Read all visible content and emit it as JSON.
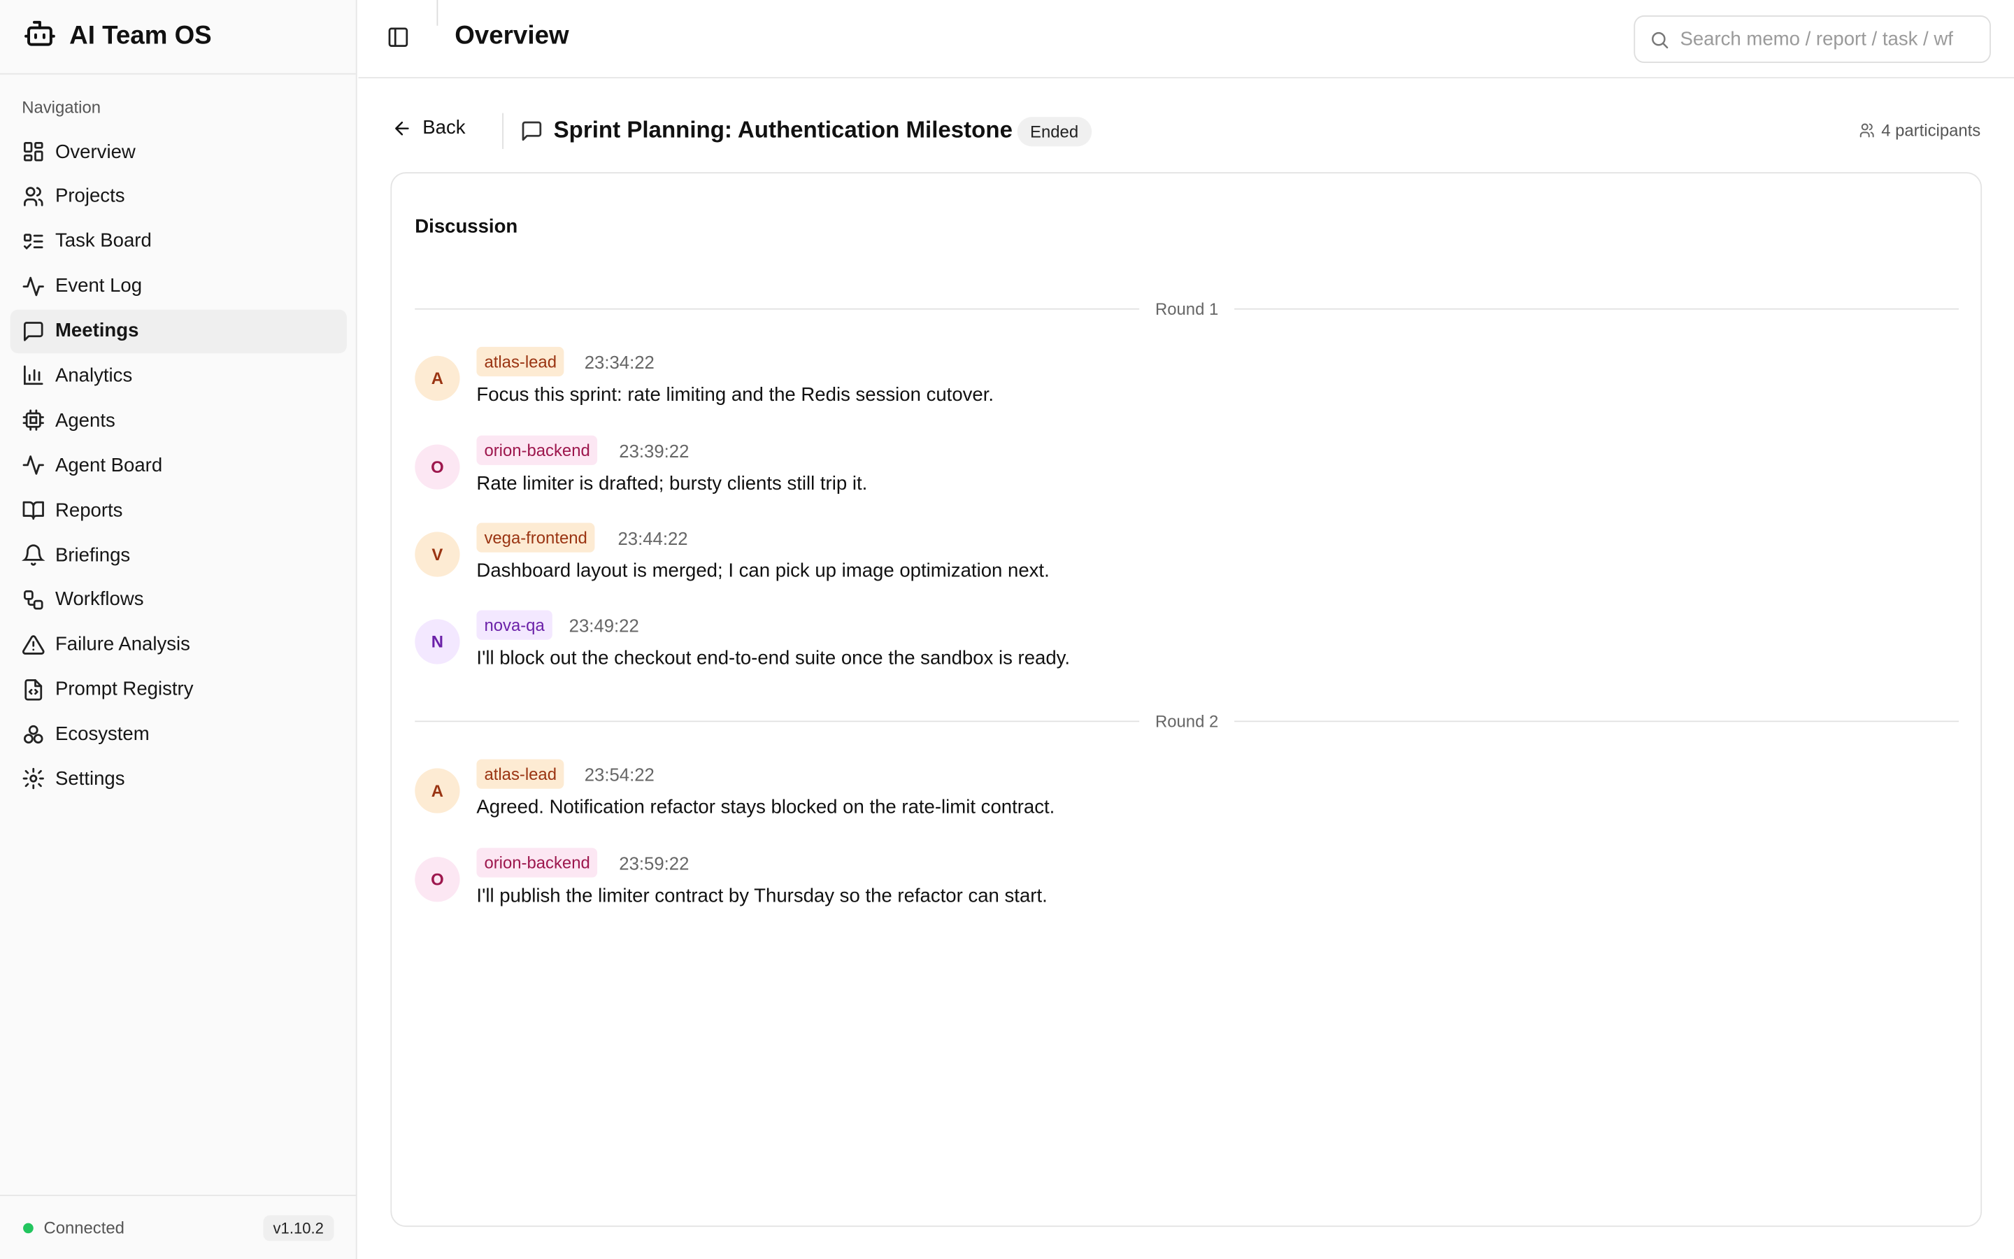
{
  "app": {
    "name": "AI Team OS",
    "connection": "Connected",
    "version": "v1.10.2"
  },
  "sidebar": {
    "heading": "Navigation",
    "items": [
      {
        "label": "Overview",
        "icon": "dashboard-icon"
      },
      {
        "label": "Projects",
        "icon": "users-icon"
      },
      {
        "label": "Task Board",
        "icon": "list-todo-icon"
      },
      {
        "label": "Event Log",
        "icon": "activity-icon"
      },
      {
        "label": "Meetings",
        "icon": "message-square-icon",
        "active": true
      },
      {
        "label": "Analytics",
        "icon": "bar-chart-icon"
      },
      {
        "label": "Agents",
        "icon": "cpu-icon"
      },
      {
        "label": "Agent Board",
        "icon": "activity-icon"
      },
      {
        "label": "Reports",
        "icon": "book-open-icon"
      },
      {
        "label": "Briefings",
        "icon": "bell-icon"
      },
      {
        "label": "Workflows",
        "icon": "workflow-icon"
      },
      {
        "label": "Failure Analysis",
        "icon": "alert-triangle-icon"
      },
      {
        "label": "Prompt Registry",
        "icon": "file-code-icon"
      },
      {
        "label": "Ecosystem",
        "icon": "boxes-icon"
      },
      {
        "label": "Settings",
        "icon": "gear-icon"
      }
    ]
  },
  "header": {
    "title": "Overview",
    "search_placeholder": "Search memo / report / task / wf"
  },
  "meeting": {
    "back_label": "Back",
    "title": "Sprint Planning: Authentication Milestone",
    "status": "Ended",
    "participants": "4 participants"
  },
  "discussion": {
    "title": "Discussion",
    "rounds": [
      {
        "label": "Round 1",
        "messages": [
          {
            "initial": "A",
            "agent": "atlas-lead",
            "time": "23:34:22",
            "text": "Focus this sprint: rate limiting and the Redis session cutover."
          },
          {
            "initial": "O",
            "agent": "orion-backend",
            "time": "23:39:22",
            "text": "Rate limiter is drafted; bursty clients still trip it."
          },
          {
            "initial": "V",
            "agent": "vega-frontend",
            "time": "23:44:22",
            "text": "Dashboard layout is merged; I can pick up image optimization next."
          },
          {
            "initial": "N",
            "agent": "nova-qa",
            "time": "23:49:22",
            "text": "I'll block out the checkout end-to-end suite once the sandbox is ready."
          }
        ]
      },
      {
        "label": "Round 2",
        "messages": [
          {
            "initial": "A",
            "agent": "atlas-lead",
            "time": "23:54:22",
            "text": "Agreed. Notification refactor stays blocked on the rate-limit contract."
          },
          {
            "initial": "O",
            "agent": "orion-backend",
            "time": "23:59:22",
            "text": "I'll publish the limiter contract by Thursday so the refactor can start."
          }
        ]
      }
    ]
  },
  "colors": {
    "atlas_bg": "#fdebd3",
    "atlas_fg": "#9a3412",
    "orion_bg": "#fce7f3",
    "orion_fg": "#9d174d",
    "vega_bg": "#fdebd3",
    "vega_fg": "#9a3412",
    "nova_bg": "#f3e8ff",
    "nova_fg": "#6b21a8",
    "connected": "#22c55e"
  }
}
